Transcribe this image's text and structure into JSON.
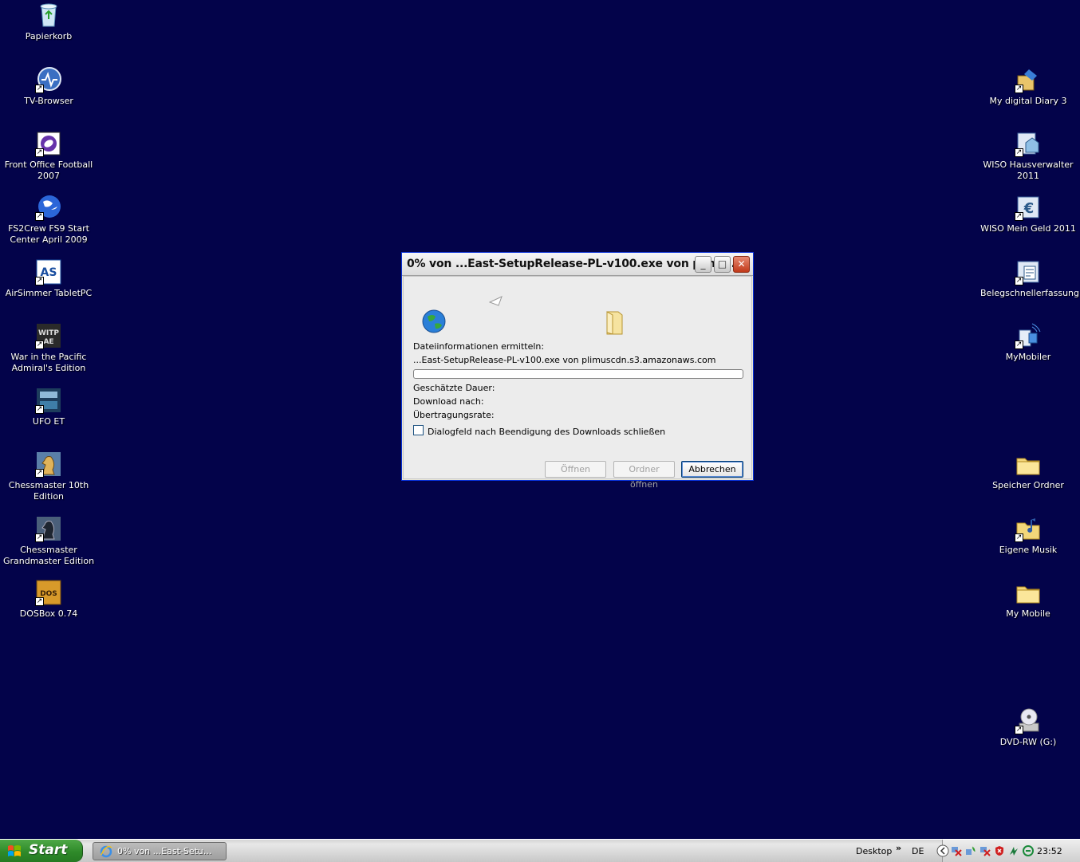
{
  "desktop": {
    "left_icons": [
      {
        "label": "Papierkorb",
        "icon": "recycle-bin-icon"
      },
      {
        "label": "TV-Browser",
        "icon": "tv-browser-icon"
      },
      {
        "label": "Front Office Football 2007",
        "icon": "football-icon"
      },
      {
        "label": "FS2Crew FS9 Start Center April 2009",
        "icon": "globe-icon"
      },
      {
        "label": "AirSimmer TabletPC",
        "icon": "airsimmer-icon"
      },
      {
        "label": "War in the Pacific Admiral's Edition",
        "icon": "witp-icon"
      },
      {
        "label": "UFO ET",
        "icon": "ufo-icon"
      },
      {
        "label": "Chessmaster 10th Edition",
        "icon": "chess-knight-icon"
      },
      {
        "label": "Chessmaster Grandmaster Edition",
        "icon": "chess-knight-dark-icon"
      },
      {
        "label": "DOSBox 0.74",
        "icon": "dosbox-icon"
      }
    ],
    "right_icons": [
      {
        "label": "My digital Diary 3",
        "icon": "diary-icon"
      },
      {
        "label": "WISO Hausverwalter 2011",
        "icon": "wiso-house-icon"
      },
      {
        "label": "WISO Mein Geld 2011",
        "icon": "wiso-money-icon"
      },
      {
        "label": "Belegschnellerfassung",
        "icon": "receipt-icon"
      },
      {
        "label": "MyMobiler",
        "icon": "mobiler-icon"
      },
      {
        "label": "Speicher Ordner",
        "icon": "folder-icon"
      },
      {
        "label": "Eigene Musik",
        "icon": "music-folder-icon"
      },
      {
        "label": "My Mobile",
        "icon": "folder-icon"
      },
      {
        "label": "DVD-RW (G:)",
        "icon": "dvd-drive-icon"
      }
    ]
  },
  "dialog": {
    "title": "0% von ...East-SetupRelease-PL-v100.exe von plimu...",
    "status_label": "Dateiinformationen ermitteln:",
    "file_line": "...East-SetupRelease-PL-v100.exe von plimuscdn.s3.amazonaws.com",
    "progress": 0.0,
    "estimated_label": "Geschätzte Dauer:",
    "download_to_label": "Download nach:",
    "transfer_rate_label": "Übertragungsrate:",
    "close_checkbox_label": "Dialogfeld nach Beendigung des Downloads schließen",
    "open_button": "Öffnen",
    "open_folder_button": "Ordner öffnen",
    "cancel_button": "Abbrechen"
  },
  "taskbar": {
    "start_label": "Start",
    "task_label": "0% von ...East-Setu...",
    "desktop_label": "Desktop",
    "chevron": "»",
    "lang": "DE",
    "clock": "23:52"
  }
}
